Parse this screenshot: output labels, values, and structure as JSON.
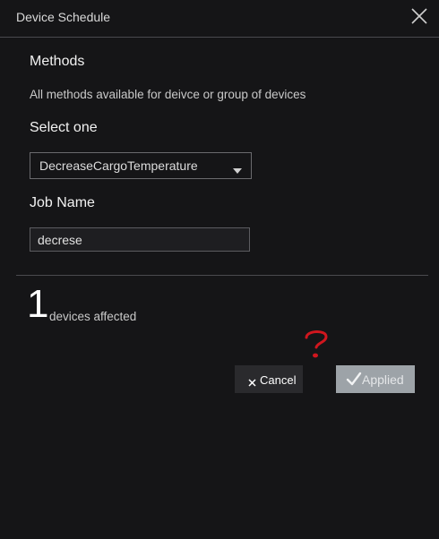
{
  "dialog": {
    "title": "Device Schedule"
  },
  "methods": {
    "heading": "Methods",
    "description": "All methods available for deivce or group of devices"
  },
  "select": {
    "heading": "Select one",
    "selected_value": "DecreaseCargoTemperature"
  },
  "job": {
    "heading": "Job Name",
    "value": "decrese"
  },
  "summary": {
    "count": "1",
    "label": "devices affected"
  },
  "actions": {
    "cancel_label": "Cancel",
    "applied_label": "Applied"
  },
  "annotation": {
    "mark_color": "#d0161e",
    "icon": "question-mark-icon"
  }
}
